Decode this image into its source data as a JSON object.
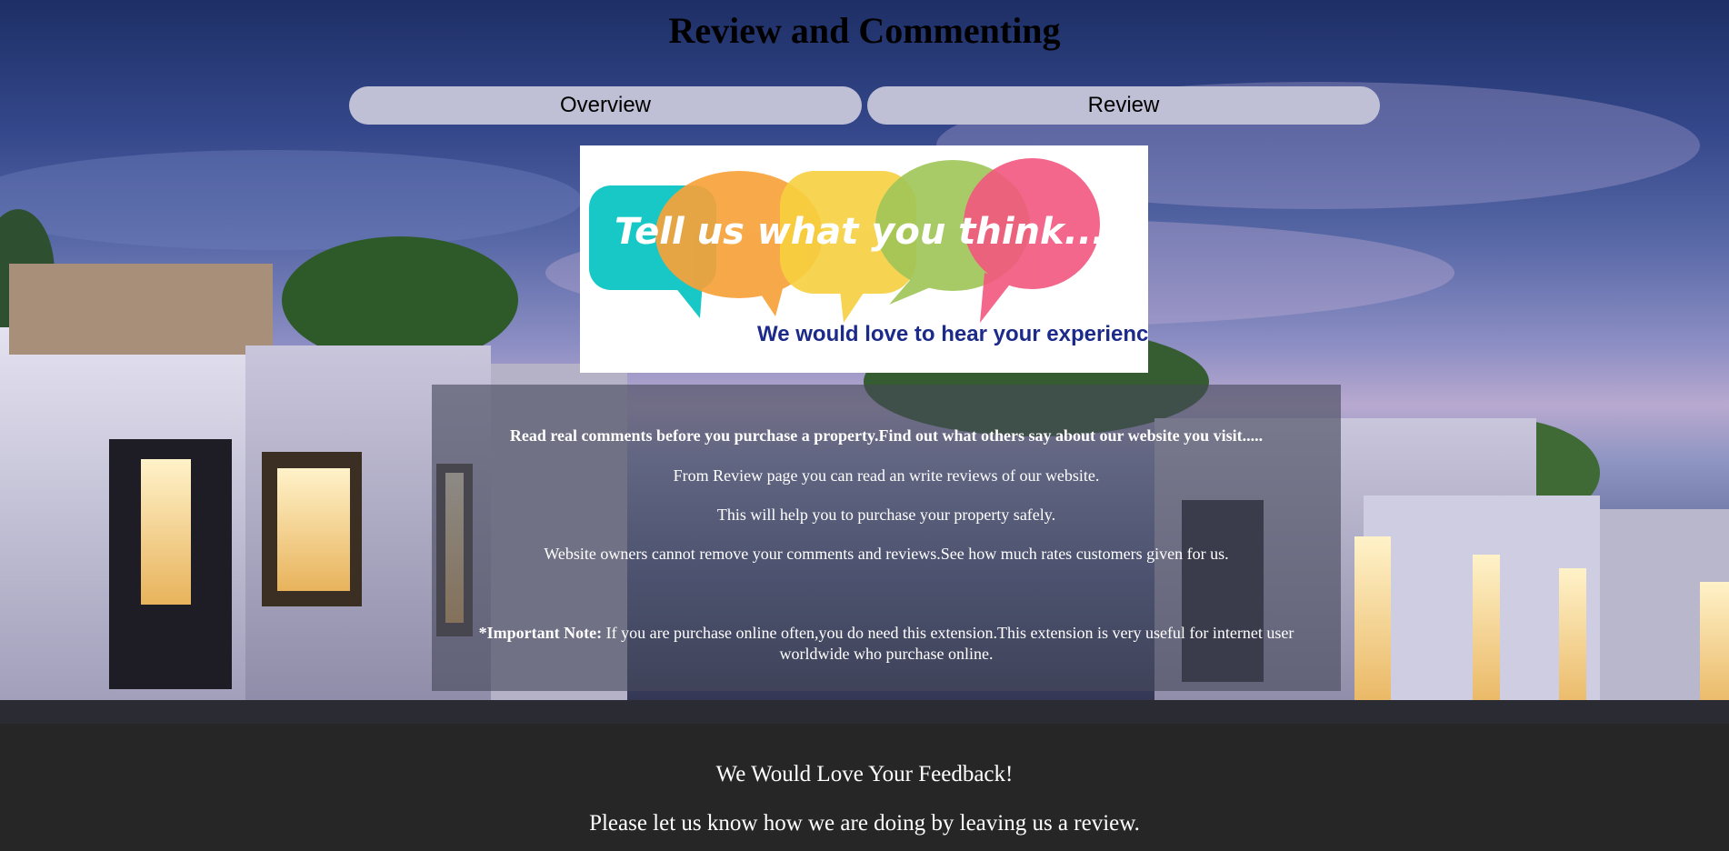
{
  "page": {
    "title": "Review and Commenting"
  },
  "tabs": [
    {
      "label": "Overview"
    },
    {
      "label": "Review"
    }
  ],
  "banner": {
    "headline": "Tell us what you think...",
    "subline": "We would love to hear your experience!",
    "bubble_colors": [
      "#17c8c6",
      "#f7a23a",
      "#f6cf3e",
      "#9fc556",
      "#f2577f"
    ],
    "subline_color": "#1c2a8a"
  },
  "info": {
    "headline": "Read real comments before you purchase a property.Find out what others say about our website you visit.....",
    "lines": [
      "From Review page you can read an write reviews of our website.",
      "This will help you to purchase your property safely.",
      "Website owners cannot remove your comments and reviews.See how much rates customers given for us."
    ],
    "note_label": "*Important Note:",
    "note_text": " If you are purchase online often,you do need this extension.This extension is very useful for internet user worldwide who purchase online."
  },
  "footer": {
    "heading": "We Would Love Your Feedback!",
    "subheading": "Please let us know how we are doing by leaving us a review."
  },
  "colors": {
    "tab_background": "#bfc0d6",
    "footer_background": "#262626",
    "panel_overlay": "rgba(70,72,90,0.62)"
  }
}
